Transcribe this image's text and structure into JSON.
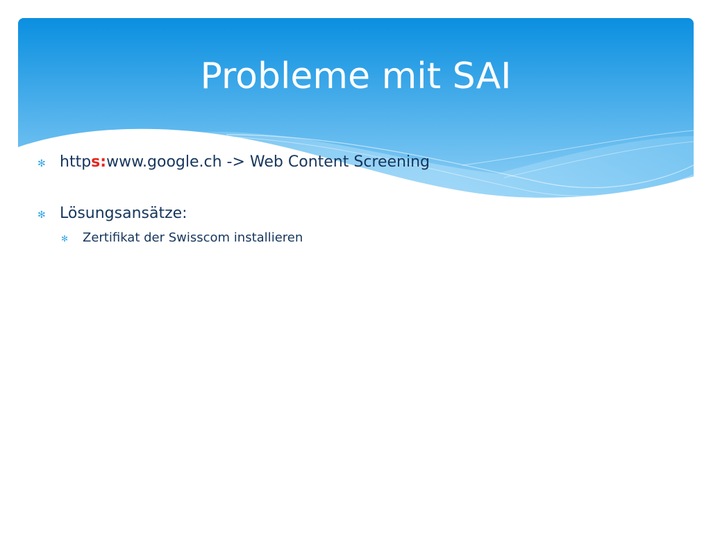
{
  "slide": {
    "title": "Probleme mit SAI",
    "colors": {
      "header_top": "#0a8fe0",
      "header_bottom": "#8fd0f6",
      "text": "#17365d",
      "bullet": "#3aa8e6",
      "highlight": "#e8261d"
    },
    "bullets": [
      {
        "prefix": "http",
        "highlight": "s:",
        "rest": "www.google.ch -> Web Content Screening"
      },
      {
        "text": "Lösungsansätze:",
        "children": [
          {
            "text": "Zertifikat der Swisscom installieren"
          }
        ]
      }
    ],
    "bullet_icon": "asterisk-bullet-icon"
  }
}
